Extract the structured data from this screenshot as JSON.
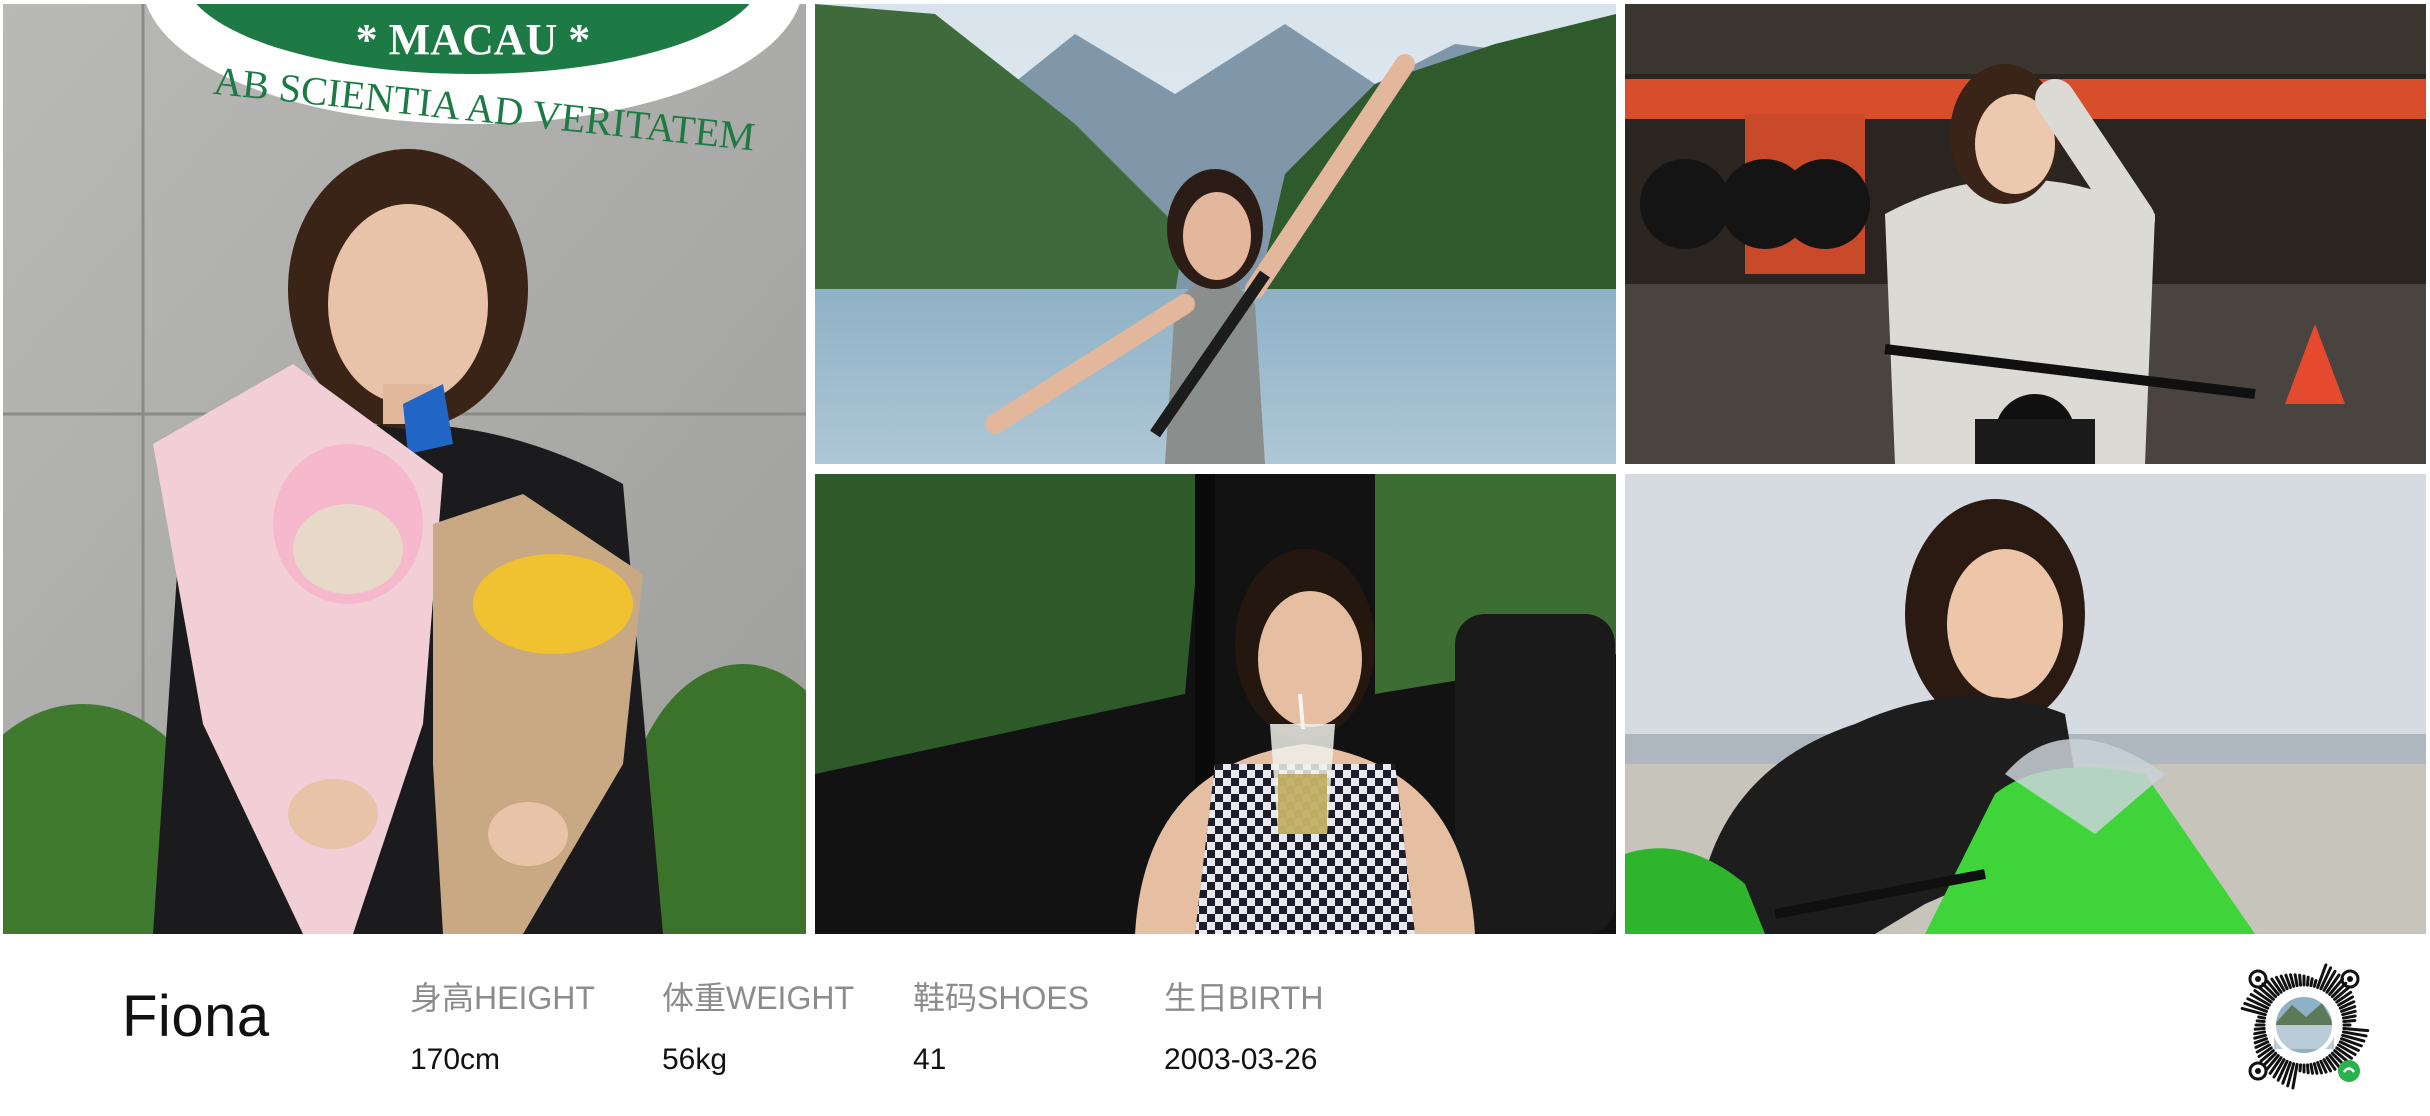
{
  "profile": {
    "name": "Fiona",
    "stats": [
      {
        "label": "身高HEIGHT",
        "value": "170cm"
      },
      {
        "label": "体重WEIGHT",
        "value": "56kg"
      },
      {
        "label": "鞋码SHOES",
        "value": "41"
      },
      {
        "label": "生日BIRTH",
        "value": "2003-03-26"
      }
    ]
  },
  "photos": {
    "graduation": {
      "seal_top": "* MACAU *",
      "seal_motto": "AB SCIENTIA AD VERITATEM"
    }
  },
  "qr": {
    "icon": "mini-program-code-icon"
  },
  "colors": {
    "seal_green": "#1e7a45",
    "bike_green": "#3ed43a",
    "text": "#111111",
    "label": "#8c8c8c"
  }
}
